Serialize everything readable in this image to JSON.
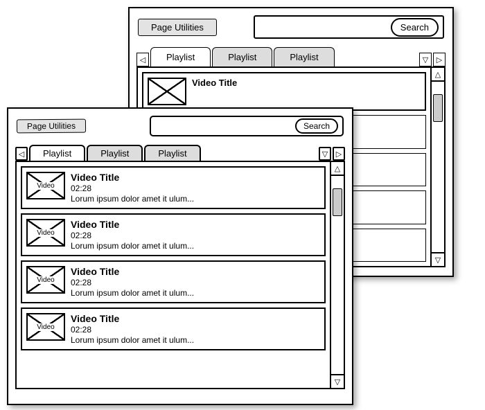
{
  "back": {
    "page_utilities_label": "Page Utilities",
    "search_button": "Search",
    "search_placeholder": "",
    "tabs": [
      "Playlist",
      "Playlist",
      "Playlist"
    ],
    "active_tab": 0,
    "item": {
      "thumb_label": "",
      "title": "Video Title",
      "time": ""
    }
  },
  "front": {
    "page_utilities_label": "Page Utilities",
    "search_button": "Search",
    "search_placeholder": "",
    "tabs": [
      "Playlist",
      "Playlist",
      "Playlist"
    ],
    "active_tab": 0,
    "items": [
      {
        "thumb_label": "Video",
        "title": "Video Title",
        "time": "02:28",
        "desc": "Lorum ipsum dolor amet it ulum..."
      },
      {
        "thumb_label": "Video",
        "title": "Video Title",
        "time": "02:28",
        "desc": "Lorum ipsum dolor amet it ulum..."
      },
      {
        "thumb_label": "Video",
        "title": "Video Title",
        "time": "02:28",
        "desc": "Lorum ipsum dolor amet it ulum..."
      },
      {
        "thumb_label": "Video",
        "title": "Video Title",
        "time": "02:28",
        "desc": "Lorum ipsum dolor amet it ulum..."
      }
    ]
  },
  "icons": {
    "triangle_left": "◁",
    "triangle_right": "▷",
    "triangle_down": "▽",
    "triangle_up": "△"
  }
}
